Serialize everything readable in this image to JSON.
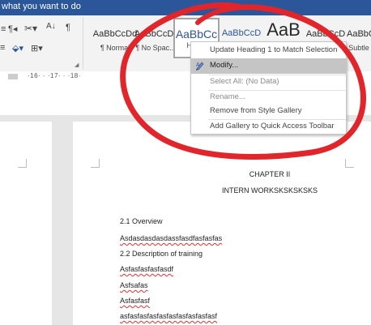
{
  "titlebar": {
    "tell_me": "what you want to do"
  },
  "ribbon": {
    "icons": {
      "para_mark": "¶",
      "sort": "A↓Z",
      "shading": "⟰",
      "bullets_caret": "¶‹",
      "dropdown": "▾"
    },
    "styles": [
      {
        "sample": "AaBbCcDd",
        "name": "¶ Normal"
      },
      {
        "sample": "AaBbCcDd",
        "name": "¶ No Spac..."
      },
      {
        "sample": "AaBbCc",
        "name": "Hea..."
      },
      {
        "sample": "AaBbCcD",
        "name": ""
      },
      {
        "sample": "AaB",
        "name": ""
      },
      {
        "sample": "AaBbCcD",
        "name": ""
      },
      {
        "sample": "AaBbCcD",
        "name": "Subtle"
      }
    ]
  },
  "ruler": {
    "text": "·16· · ·17· · ·18·"
  },
  "context_menu": {
    "items": [
      {
        "label": "Update Heading 1 to Match Selection",
        "state": "enabled"
      },
      {
        "label": "Modify...",
        "state": "hover"
      },
      {
        "label": "Select All: (No Data)",
        "state": "disabled"
      },
      {
        "label": "Rename...",
        "state": "disabled"
      },
      {
        "label": "Remove from Style Gallery",
        "state": "enabled"
      },
      {
        "label": "Add Gallery to Quick Access Toolbar",
        "state": "enabled"
      }
    ]
  },
  "document": {
    "chapter": "CHAPTER II",
    "heading": "INTERN WORKSKSKSKSKS",
    "lines": [
      "2.1 Overview",
      "Asdasdasdasdassfasdfasfasfas",
      "2.2 Description of training",
      "Asfasfasfasfasdf",
      "Asfsafas",
      "Asfasfasf",
      "asfasfasfasfasfasfasfasfasfasf"
    ]
  },
  "colors": {
    "titlebar": "#2b579a",
    "annotation": "#e0252b",
    "heading_blue": "#2f5496"
  }
}
